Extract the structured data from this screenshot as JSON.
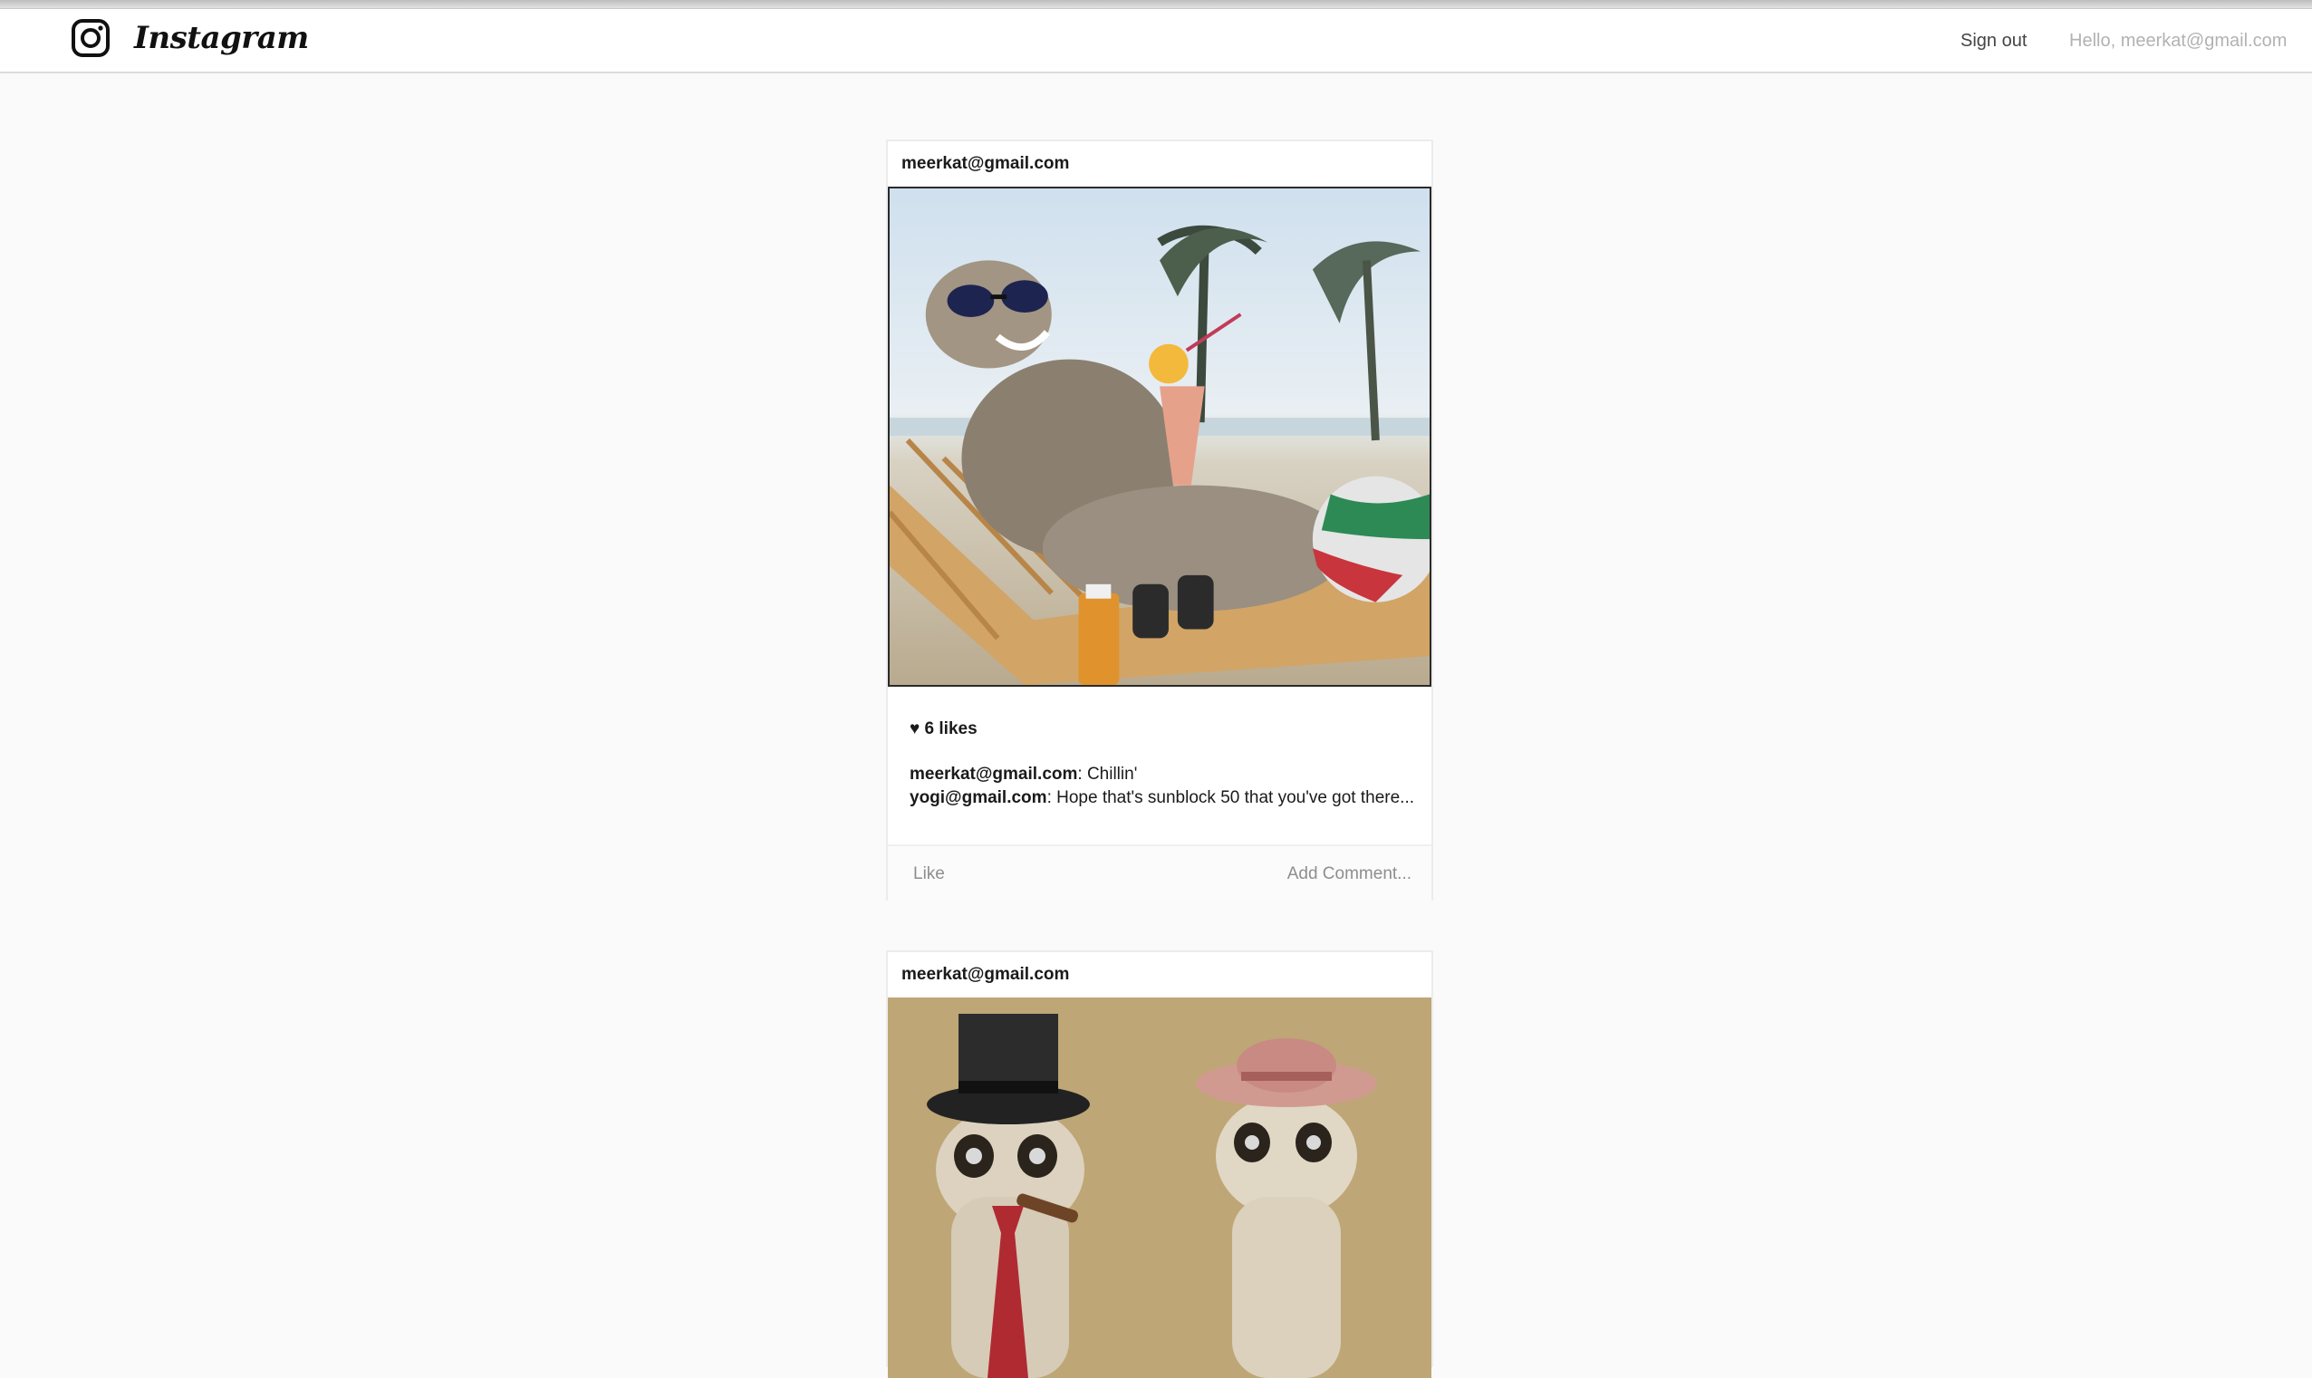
{
  "app": {
    "name": "Instagram"
  },
  "navbar": {
    "logo_icon": "camera-icon",
    "sign_out_label": "Sign out",
    "greeting": "Hello, meerkat@gmail.com"
  },
  "posts": [
    {
      "author": "meerkat@gmail.com",
      "image": "meerkat-beach-photo",
      "likes_label": "♥ 6 likes",
      "comments": [
        {
          "author": "meerkat@gmail.com",
          "sep": ":",
          "text": " Chillin'"
        },
        {
          "author": "yogi@gmail.com",
          "sep": ":",
          "text": " Hope that's sunblock 50 that you've got there..."
        }
      ],
      "like_label": "Like",
      "add_comment_label": "Add Comment..."
    },
    {
      "author": "meerkat@gmail.com",
      "image": "meerkats-hats-photo"
    }
  ],
  "colors": {
    "background": "#fafafa",
    "card": "#ffffff",
    "muted_text": "#8e8e8e",
    "greeting_text": "#b2b2b2"
  }
}
